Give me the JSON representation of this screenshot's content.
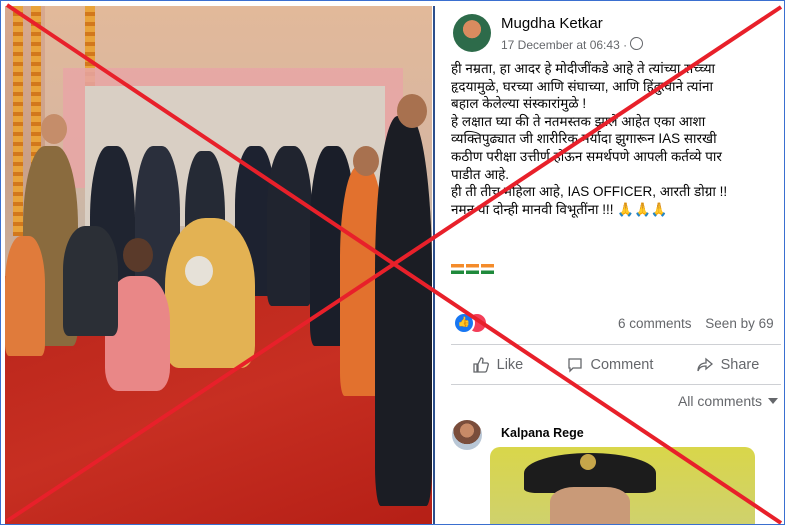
{
  "post": {
    "author": "Mugdha Ketkar",
    "timestamp": "17 December at 06:43 ·",
    "audience_icon": "globe-icon",
    "body_lines": [
      "ही नम्रता, हा आदर हे मोदीजींकडे आहे ते त्यांच्या सच्च्या",
      "हृदयामुळे, घरच्या आणि संघाच्या, आणि हिंदुत्वाने त्यांना",
      "बहाल केलेल्या संस्कारांमुळे !",
      "हे लक्षात घ्या की ते नतमस्तक झाले आहेत एका आशा",
      "व्यक्तिपुढ्यात जी शारीरिक मर्यादा झुगारून IAS सारखी",
      "कठीण परीक्षा उत्तीर्ण होऊन समर्थपणे आपली कर्तव्ये पार",
      "पाडीत आहे.",
      "ही ती तीच महिला आहे, IAS OFFICER, आरती डोग्रा !!",
      "नमन या दोन्ही मानवी विभूतींना !!! 🙏🙏🙏"
    ],
    "flags_count": 3,
    "comments_count": "6 comments",
    "seen_by": "Seen by 69",
    "actions": {
      "like": "Like",
      "comment": "Comment",
      "share": "Share"
    },
    "all_comments": "All comments"
  },
  "comment": {
    "author": "Kalpana Rege"
  },
  "colors": {
    "fb_blue": "#1877f2",
    "text_secondary": "#65676b",
    "cross_red": "#e8202a",
    "carpet_red": "#c12f23"
  }
}
